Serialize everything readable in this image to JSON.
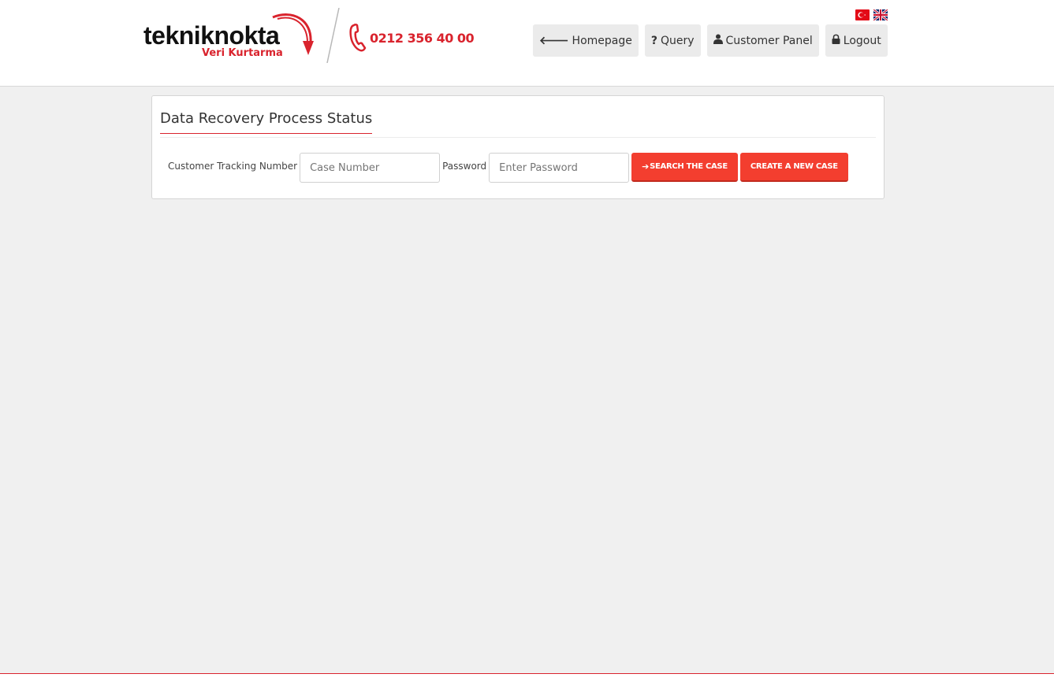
{
  "brand": {
    "logo_main": "tekniknokta",
    "logo_sub": "Veri Kurtarma",
    "phone": "0212 356 40 00",
    "accent_color": "#d9232d"
  },
  "languages": [
    {
      "code": "tr",
      "icon": "turkish-flag-icon"
    },
    {
      "code": "en",
      "icon": "uk-flag-icon"
    }
  ],
  "nav": {
    "items": [
      {
        "label": "Homepage",
        "icon": "arrow-left-icon"
      },
      {
        "label": "Query",
        "icon": "question-icon"
      },
      {
        "label": "Customer Panel",
        "icon": "user-icon"
      },
      {
        "label": "Logout",
        "icon": "lock-icon"
      }
    ]
  },
  "panel": {
    "title": "Data Recovery Process Status",
    "tracking_label": "Customer Tracking Number",
    "tracking_placeholder": "Case Number",
    "password_label": "Password",
    "password_placeholder": "Enter Password",
    "search_button": "SEARCH THE CASE",
    "create_button": "CREATE A NEW CASE",
    "button_color": "#f33e2f"
  }
}
